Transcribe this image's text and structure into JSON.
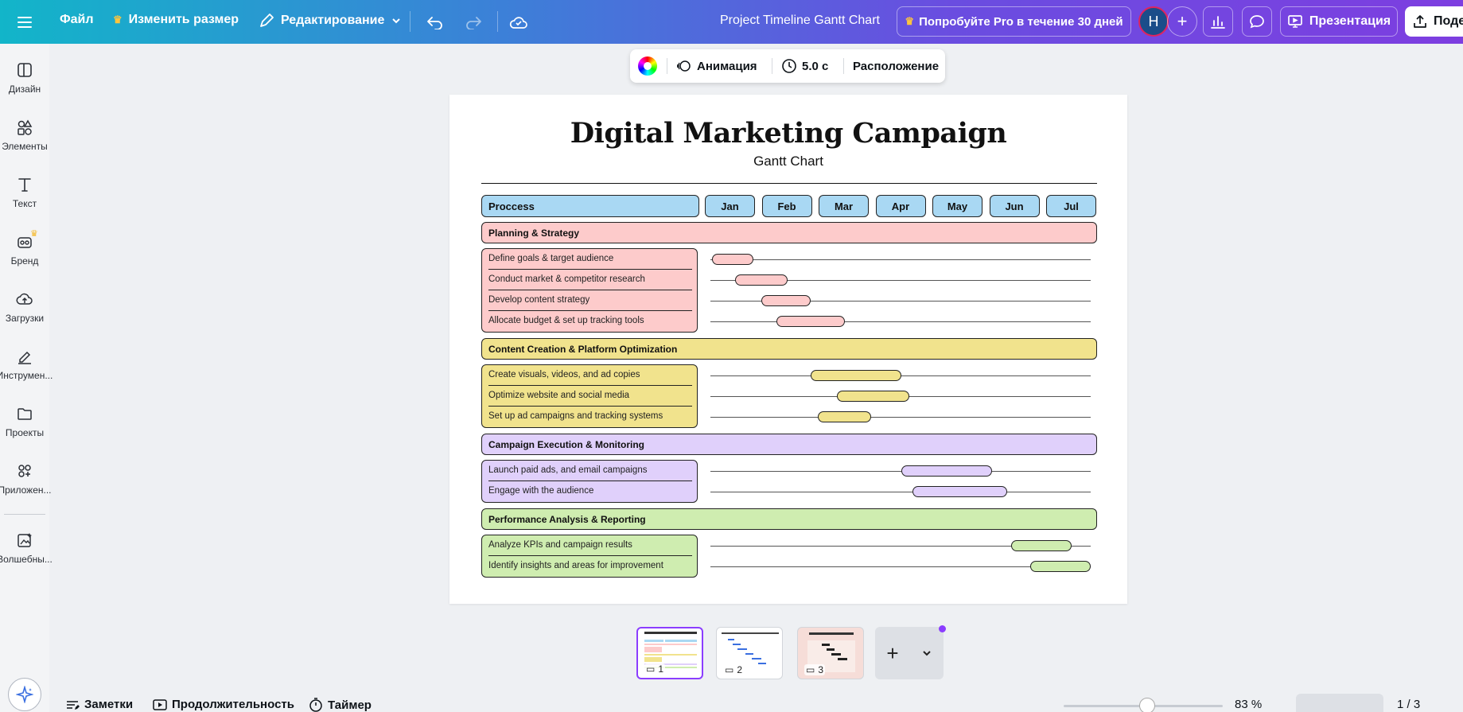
{
  "topbar": {
    "file": "Файл",
    "resize": "Изменить размер",
    "editing": "Редактирование",
    "doc_title": "Project Timeline Gantt Chart",
    "pro": "Попробуйте Pro в течение 30 дней",
    "avatar": "H",
    "present": "Презентация",
    "share": "Поде"
  },
  "sidebar": {
    "items": [
      {
        "label": "Дизайн",
        "icon": "layout-icon"
      },
      {
        "label": "Элементы",
        "icon": "shapes-icon"
      },
      {
        "label": "Текст",
        "icon": "text-icon"
      },
      {
        "label": "Бренд",
        "icon": "brand-icon"
      },
      {
        "label": "Загрузки",
        "icon": "upload-cloud-icon"
      },
      {
        "label": "Инструмен...",
        "icon": "draw-icon"
      },
      {
        "label": "Проекты",
        "icon": "folder-icon"
      },
      {
        "label": "Приложен...",
        "icon": "apps-icon"
      },
      {
        "label": "Волшебны...",
        "icon": "magic-media-icon"
      }
    ]
  },
  "float_toolbar": {
    "animation": "Анимация",
    "duration": "5.0 с",
    "position": "Расположение"
  },
  "document": {
    "title": "Digital Marketing Campaign",
    "subtitle": "Gantt Chart",
    "header_label": "Proccess",
    "months": [
      "Jan",
      "Feb",
      "Mar",
      "Apr",
      "May",
      "Jun",
      "Jul"
    ],
    "phases": [
      {
        "name": "Planning & Strategy",
        "color": "#fdcbcb",
        "tasks": [
          {
            "name": "Define goals & target audience",
            "start": 0.0,
            "end": 0.11
          },
          {
            "name": "Conduct market & competitor research",
            "start": 0.06,
            "end": 0.2
          },
          {
            "name": "Develop content strategy",
            "start": 0.13,
            "end": 0.26
          },
          {
            "name": "Allocate budget & set up tracking tools",
            "start": 0.17,
            "end": 0.35
          }
        ]
      },
      {
        "name": "Content Creation & Platform Optimization",
        "color": "#f1e38d",
        "tasks": [
          {
            "name": "Create visuals, videos, and ad copies",
            "start": 0.26,
            "end": 0.5
          },
          {
            "name": "Optimize website and social media",
            "start": 0.33,
            "end": 0.52
          },
          {
            "name": "Set up ad campaigns and tracking systems",
            "start": 0.28,
            "end": 0.42
          }
        ]
      },
      {
        "name": "Campaign Execution & Monitoring",
        "color": "#e0d0fb",
        "tasks": [
          {
            "name": "Launch paid ads, and email campaigns",
            "start": 0.5,
            "end": 0.74
          },
          {
            "name": "Engage with the audience",
            "start": 0.53,
            "end": 0.78
          }
        ]
      },
      {
        "name": "Performance Analysis & Reporting",
        "color": "#cfedb0",
        "tasks": [
          {
            "name": "Analyze KPIs and campaign results",
            "start": 0.79,
            "end": 0.95
          },
          {
            "name": "Identify insights and areas for improvement",
            "start": 0.84,
            "end": 1.0
          }
        ]
      }
    ]
  },
  "thumbnails": [
    {
      "num": "1",
      "active": true
    },
    {
      "num": "2",
      "active": false
    },
    {
      "num": "3",
      "active": false
    }
  ],
  "bottombar": {
    "notes": "Заметки",
    "duration": "Продолжительность",
    "timer": "Таймер",
    "zoom": "83 %",
    "page_count": "1 / 3"
  }
}
